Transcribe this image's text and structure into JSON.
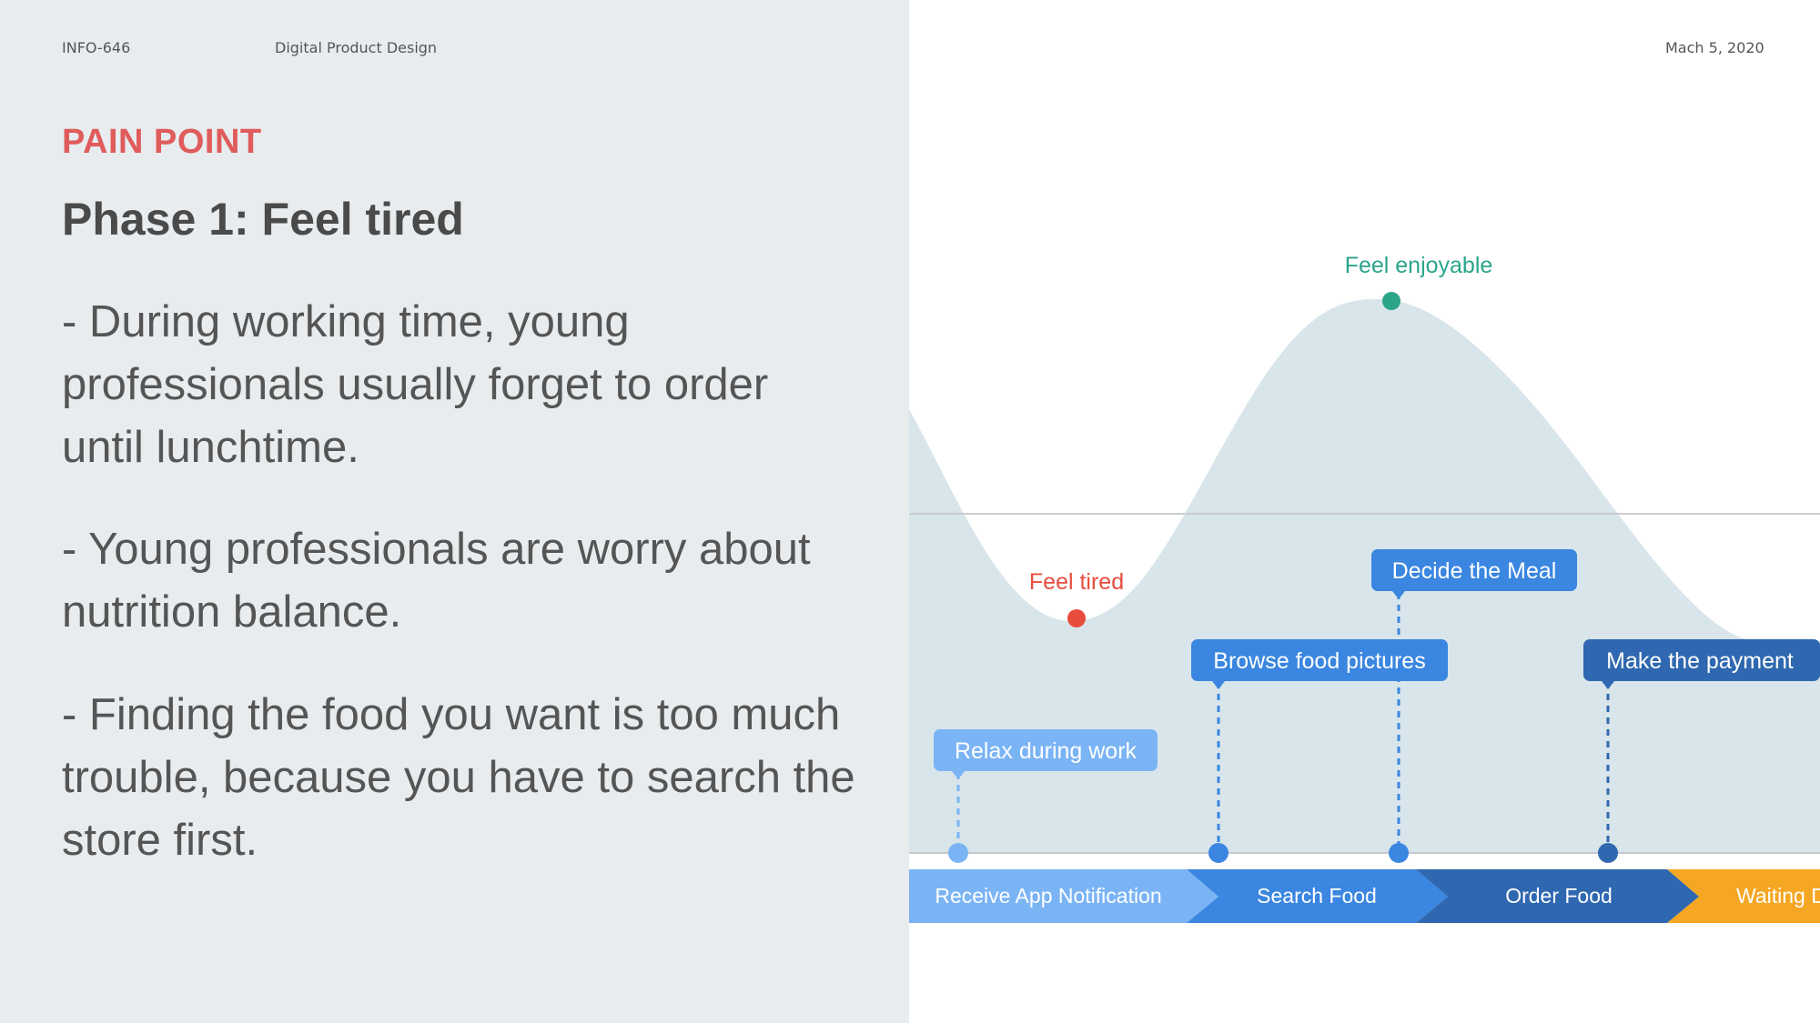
{
  "header": {
    "course": "INFO-646",
    "subject": "Digital Product Design",
    "date": "Mach 5, 2020"
  },
  "slide": {
    "section": "PAIN POINT",
    "title": "Phase 1: Feel tired",
    "bullets": [
      {
        "lines": [
          "- During working time, young",
          "professionals usually forget to order",
          "until lunchtime."
        ]
      },
      {
        "lines": [
          "- Young professionals are worry about",
          "nutrition balance."
        ]
      },
      {
        "lines": [
          "- Finding the food you want is too much",
          "trouble, because you have to search the",
          "store first."
        ]
      }
    ]
  },
  "journey": {
    "emotions": [
      {
        "label": "Feel enjoyable",
        "color": "#2aa58a"
      },
      {
        "label": "Feel tired",
        "color": "#e84c3d"
      }
    ],
    "actions": [
      {
        "label": "Relax during work",
        "color": "#7ab4f5"
      },
      {
        "label": "Browse food pictures",
        "color": "#3a86e0"
      },
      {
        "label": "Decide the Meal",
        "color": "#3a86e0"
      },
      {
        "label": "Make the payment",
        "color": "#2f68b0"
      }
    ],
    "stages": [
      {
        "label": "Receive App Notification",
        "color": "#7ab4f5"
      },
      {
        "label": "Search Food",
        "color": "#3a86e0"
      },
      {
        "label": "Order Food",
        "color": "#2f68b0"
      },
      {
        "label": "Waiting D",
        "color": "#f5a623"
      }
    ],
    "curve_color": "#d8e5ea"
  }
}
